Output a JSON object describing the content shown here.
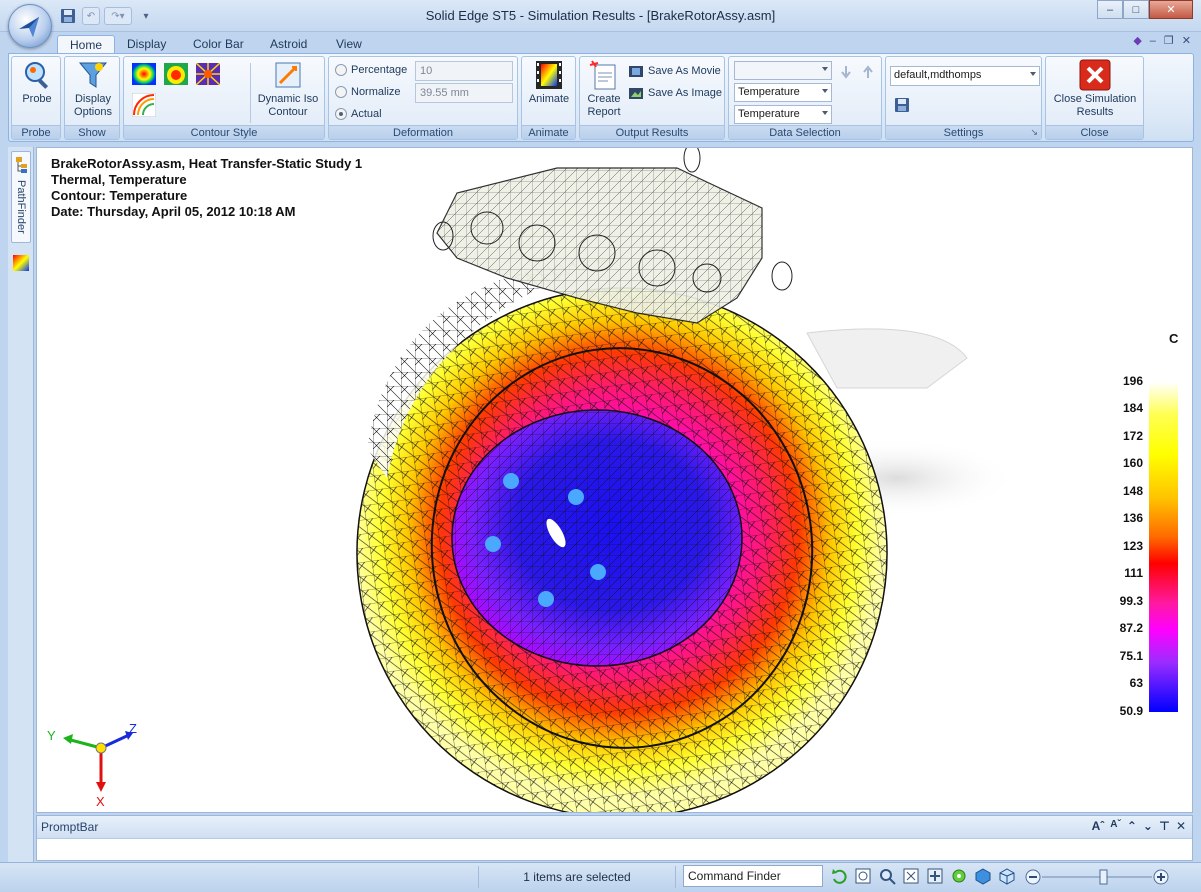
{
  "window": {
    "title": "Solid Edge ST5 - Simulation Results - [BrakeRotorAssy.asm]"
  },
  "tabs": [
    "Home",
    "Display",
    "Color Bar",
    "Astroid",
    "View"
  ],
  "ribbon": {
    "probe": {
      "button": "Probe",
      "group": "Probe"
    },
    "show": {
      "button": "Display Options",
      "group": "Show"
    },
    "contour_style": {
      "dynamic_iso": "Dynamic Iso Contour",
      "group": "Contour Style"
    },
    "deformation": {
      "percentage_label": "Percentage",
      "percentage_value": "10",
      "normalize_label": "Normalize",
      "normalize_value": "39.55 mm",
      "actual_label": "Actual",
      "selected": "Actual",
      "group": "Deformation"
    },
    "animate": {
      "button": "Animate",
      "group": "Animate"
    },
    "output": {
      "create_report": "Create Report",
      "save_movie": "Save As Movie",
      "save_image": "Save As Image",
      "group": "Output Results"
    },
    "data_selection": {
      "dd1": "",
      "dd2": "Temperature",
      "dd3": "Temperature",
      "group": "Data Selection"
    },
    "settings": {
      "value": "default,mdthomps",
      "group": "Settings"
    },
    "close": {
      "button": "Close Simulation Results",
      "group": "Close"
    }
  },
  "pathfinder": {
    "label": "PathFinder"
  },
  "info": {
    "line1": "BrakeRotorAssy.asm, Heat Transfer-Static Study 1",
    "line2": "Thermal, Temperature",
    "line3": "Contour: Temperature",
    "line4": "Date: Thursday, April 05, 2012  10:18 AM"
  },
  "legend": {
    "unit": "C",
    "values": [
      "196",
      "184",
      "172",
      "160",
      "148",
      "136",
      "123",
      "111",
      "99.3",
      "87.2",
      "75.1",
      "63",
      "50.9"
    ]
  },
  "axes": {
    "x": "X",
    "y": "Y",
    "z": "Z"
  },
  "promptbar": {
    "title": "PromptBar"
  },
  "status": {
    "selection": "1 items are selected",
    "command_finder": "Command Finder"
  }
}
